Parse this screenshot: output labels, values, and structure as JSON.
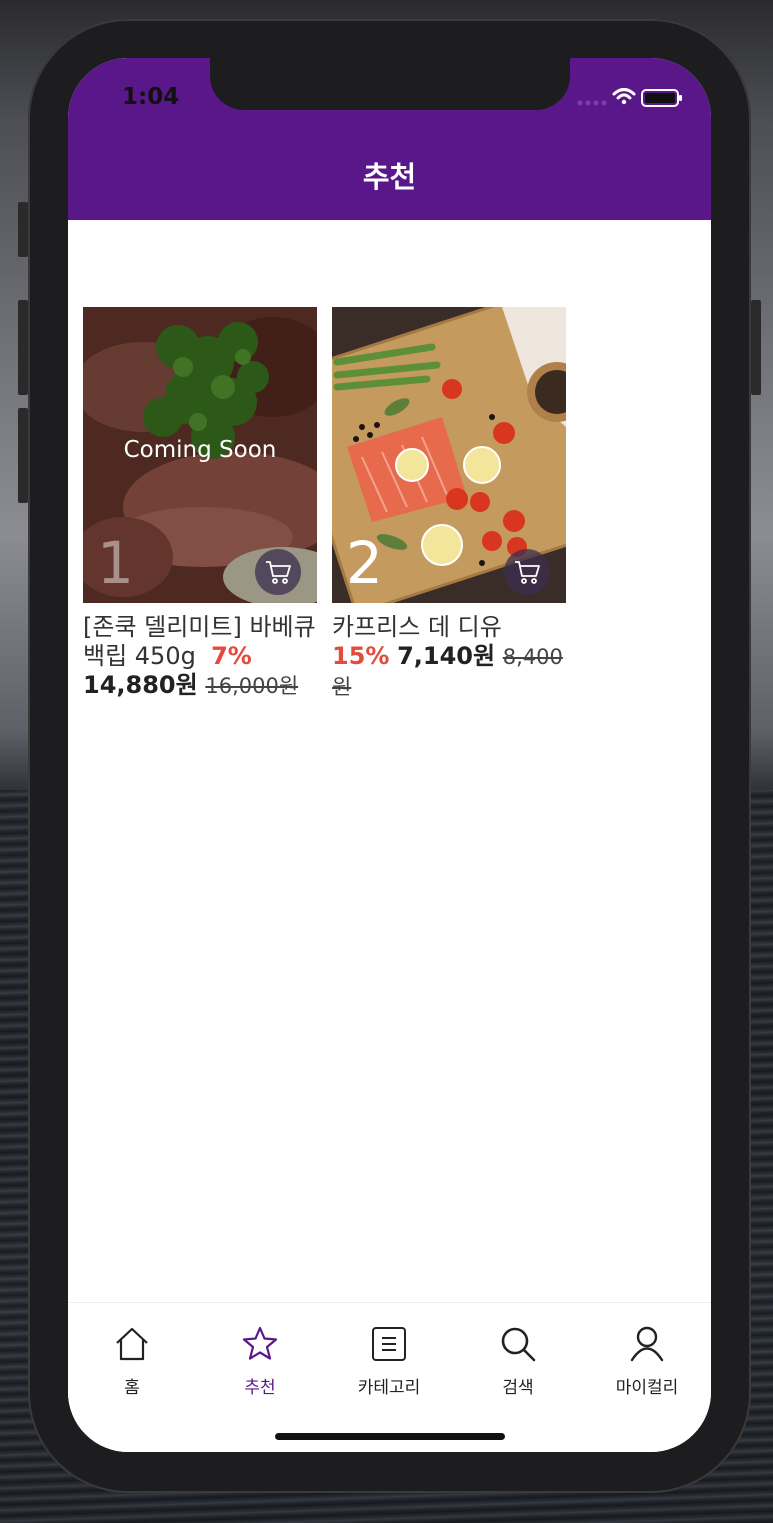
{
  "status": {
    "time": "1:04"
  },
  "header": {
    "title": "추천"
  },
  "products": [
    {
      "rank": "1",
      "overlay": "Coming Soon",
      "name": "[존쿡 델리미트] 바베큐 백립 450g",
      "discount": "7%",
      "price": "14,880원",
      "original_price": "16,000원"
    },
    {
      "rank": "2",
      "overlay": "",
      "name": "카프리스 데 디유",
      "discount": "15%",
      "price": "7,140원",
      "original_price": "8,400원"
    }
  ],
  "tabs": [
    {
      "label": "홈",
      "icon": "home-icon",
      "active": false
    },
    {
      "label": "추천",
      "icon": "star-icon",
      "active": true
    },
    {
      "label": "카테고리",
      "icon": "list-icon",
      "active": false
    },
    {
      "label": "검색",
      "icon": "search-icon",
      "active": false
    },
    {
      "label": "마이컬리",
      "icon": "user-icon",
      "active": false
    }
  ],
  "colors": {
    "brand": "#5a1789",
    "discount": "#e34b3c"
  }
}
